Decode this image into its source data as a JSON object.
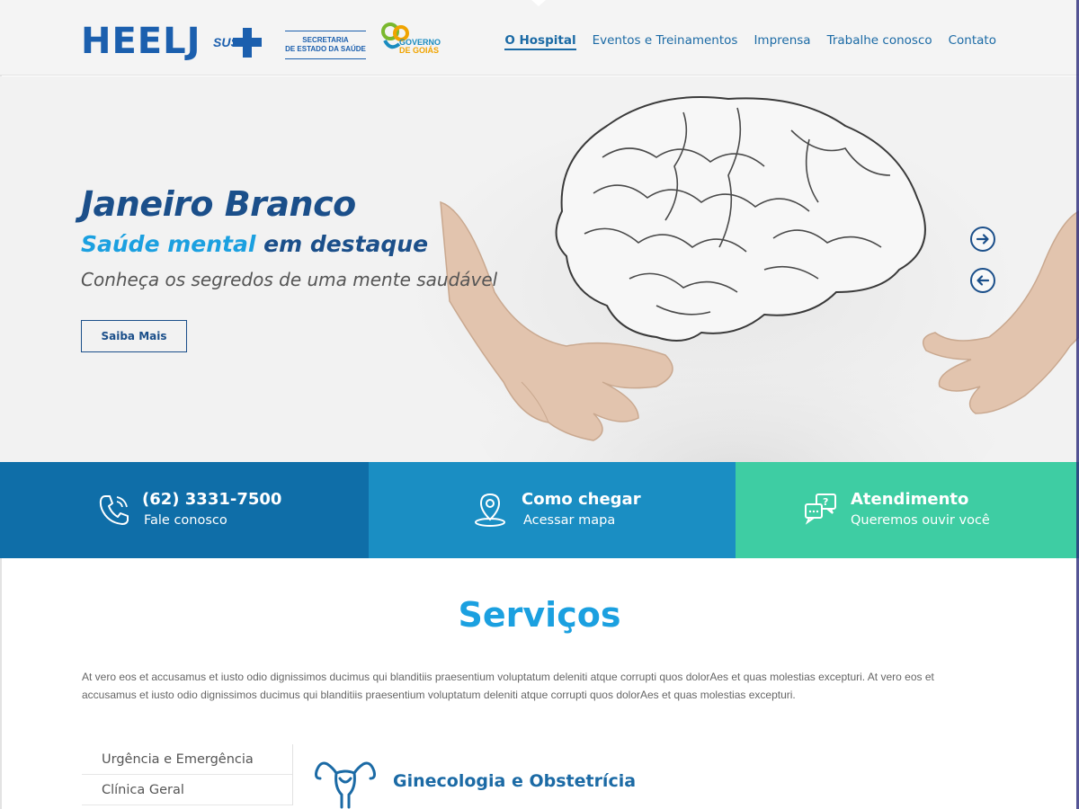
{
  "header": {
    "logo": "HEELJ",
    "sus_logo": "SUS",
    "ses_logo_line1": "SECRETARIA",
    "ses_logo_line2": "DE ESTADO DA SAÚDE",
    "goias_logo_line1": "GOVERNO",
    "goias_logo_line2": "DE GOIÁS",
    "nav": [
      {
        "label": "O Hospital",
        "active": true
      },
      {
        "label": "Eventos e Treinamentos",
        "active": false
      },
      {
        "label": "Imprensa",
        "active": false
      },
      {
        "label": "Trabalhe conosco",
        "active": false
      },
      {
        "label": "Contato",
        "active": false
      }
    ]
  },
  "hero": {
    "title": "Janeiro Branco",
    "subtitle_highlight": "Saúde mental",
    "subtitle_rest": " em destaque",
    "tagline": "Conheça os segredos de uma mente saudável",
    "button_label": "Saiba Mais",
    "next_icon": "arrow-right-circle-icon",
    "prev_icon": "arrow-left-circle-icon"
  },
  "infobar": {
    "phone": {
      "title": "(62) 3331-7500",
      "subtitle": "Fale conosco",
      "icon": "phone-icon",
      "color": "#0f6ea8"
    },
    "map": {
      "title": "Como chegar",
      "subtitle": "Acessar mapa",
      "icon": "map-pin-icon",
      "color": "#1a8ec3"
    },
    "attendance": {
      "title": "Atendimento",
      "subtitle": "Queremos ouvir você",
      "icon": "chat-question-icon",
      "color": "#3ecda3"
    }
  },
  "services": {
    "title": "Serviços",
    "description": "At vero eos et accusamus et iusto odio dignissimos ducimus qui blanditiis praesentium voluptatum deleniti atque corrupti quos dolorAes et quas molestias excepturi. At vero eos et accusamus et iusto odio dignissimos ducimus qui blanditiis praesentium voluptatum deleniti atque corrupti quos dolorAes et quas molestias excepturi.",
    "list": [
      {
        "label": "Urgência e Emergência"
      },
      {
        "label": "Clínica Geral"
      }
    ],
    "detail": {
      "title": "Ginecologia e Obstetrícia",
      "icon": "uterus-icon"
    }
  },
  "colors": {
    "brand_blue": "#1b5fae",
    "accent_cyan": "#1ba0e0",
    "dark_navy": "#1b4f8a",
    "teal": "#3ecda3"
  }
}
